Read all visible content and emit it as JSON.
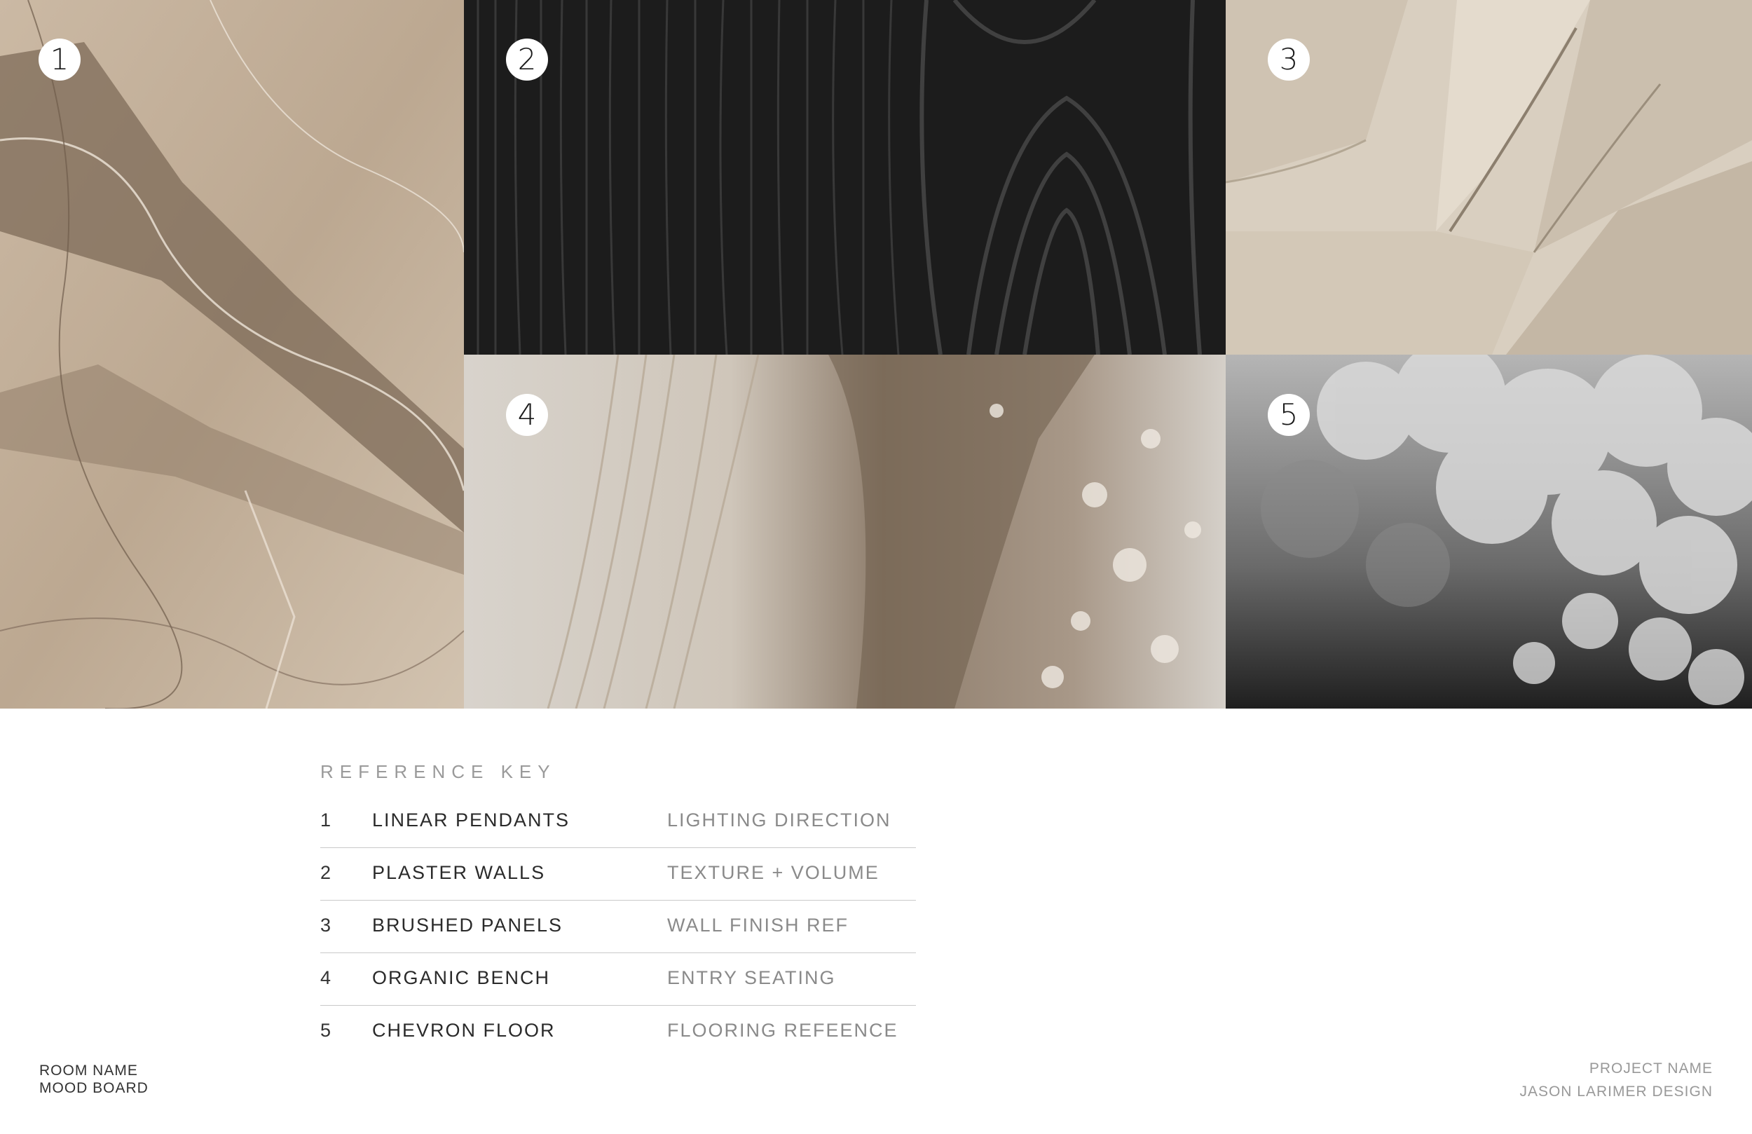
{
  "tiles": [
    {
      "number": "1",
      "name": "marble"
    },
    {
      "number": "2",
      "name": "dark-oak-wood"
    },
    {
      "number": "3",
      "name": "rough-stone"
    },
    {
      "number": "4",
      "name": "onyx-terrazzo"
    },
    {
      "number": "5",
      "name": "clouds"
    }
  ],
  "reference_key": {
    "title": "REFERENCE KEY",
    "rows": [
      {
        "num": "1",
        "item": "LINEAR PENDANTS",
        "note": "LIGHTING DIRECTION"
      },
      {
        "num": "2",
        "item": "PLASTER WALLS",
        "note": "TEXTURE + VOLUME"
      },
      {
        "num": "3",
        "item": "BRUSHED PANELS",
        "note": "WALL FINISH REF"
      },
      {
        "num": "4",
        "item": "ORGANIC BENCH",
        "note": "ENTRY SEATING"
      },
      {
        "num": "5",
        "item": "CHEVRON FLOOR",
        "note": "FLOORING REFEENCE"
      }
    ]
  },
  "footer": {
    "room_name": "ROOM NAME",
    "board_type": "MOOD BOARD",
    "project_name": "PROJECT NAME",
    "designer": "JASON LARIMER DESIGN"
  },
  "colors": {
    "marble": "#b9a58e",
    "wood": "#1e1e1e",
    "stone": "#d8cdbd",
    "onyx": "#bdb3a6",
    "clouds": "#7a7a7a"
  }
}
